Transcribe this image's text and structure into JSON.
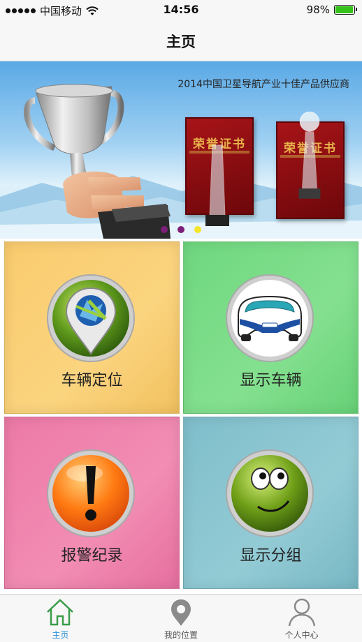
{
  "status_bar": {
    "carrier": "中国移动",
    "time": "14:56",
    "battery_percent": "98%",
    "battery_level": 0.98
  },
  "nav": {
    "title": "主页"
  },
  "banner": {
    "caption": "2014中国卫星导航产业十佳产品供应商",
    "certificate_text": "荣誉证书",
    "pages": 3,
    "active_page": 3
  },
  "tiles": [
    {
      "label": "车辆定位",
      "icon": "location-pin-icon",
      "color": "#f9cb6e"
    },
    {
      "label": "显示车辆",
      "icon": "car-icon",
      "color": "#6fd77f"
    },
    {
      "label": "报警纪录",
      "icon": "alert-icon",
      "color": "#ec79a7"
    },
    {
      "label": "显示分组",
      "icon": "smiley-icon",
      "color": "#7fbecb"
    }
  ],
  "tab_bar": {
    "tabs": [
      {
        "label": "主页",
        "icon": "home-icon",
        "active": true
      },
      {
        "label": "我的位置",
        "icon": "location-icon",
        "active": false
      },
      {
        "label": "个人中心",
        "icon": "person-icon",
        "active": false
      }
    ],
    "active_color": "#2a8fd9"
  }
}
